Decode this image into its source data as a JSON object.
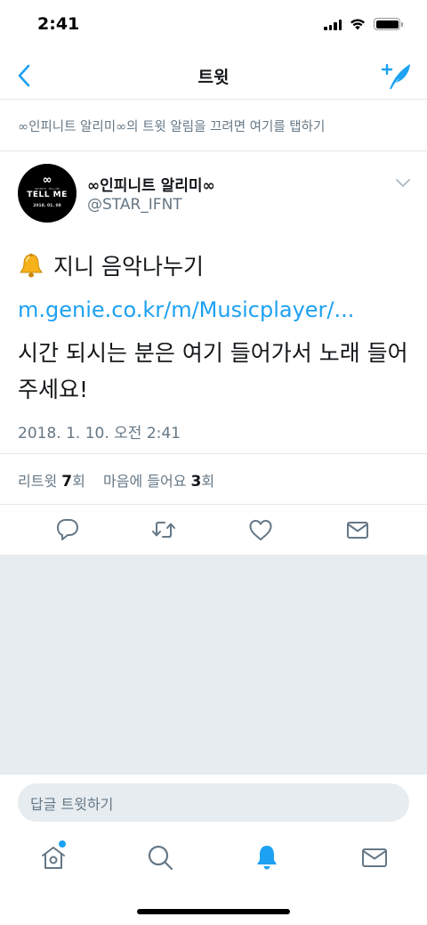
{
  "status_bar": {
    "time": "2:41"
  },
  "nav": {
    "title": "트윗"
  },
  "notification_hint": "∞인피니트 알리미∞의 트윗 알림을 끄려면 여기를 탭하기",
  "tweet": {
    "avatar": {
      "logo": "∞",
      "tagline": "INFINITE · TELL ME",
      "title": "TELL ME",
      "date": "2018. 01. 08"
    },
    "display_name": "∞인피니트 알리미∞",
    "handle": "@STAR_IFNT",
    "line1_text": "지니 음악나누기",
    "line1_emoji": "bell",
    "link": "m.genie.co.kr/m/Musicplayer/...",
    "body": "시간 되시는 분은 여기 들어가서 노래 들어주세요!",
    "timestamp": "2018. 1. 10. 오전 2:41"
  },
  "stats": {
    "retweets_label": "리트윗",
    "retweets_count": "7",
    "retweets_unit": "회",
    "likes_label": "마음에 들어요",
    "likes_count": "3",
    "likes_unit": "회"
  },
  "actions": [
    "reply-icon",
    "retweet-icon",
    "like-icon",
    "dm-icon"
  ],
  "reply_bar": {
    "placeholder": "답글 트윗하기"
  },
  "tabs": [
    "home-icon",
    "search-icon",
    "notifications-icon",
    "messages-icon"
  ],
  "colors": {
    "accent": "#1da1f2",
    "secondary_text": "#657786",
    "divider": "#e1e8ed",
    "background_gray": "#e6ecf0"
  }
}
